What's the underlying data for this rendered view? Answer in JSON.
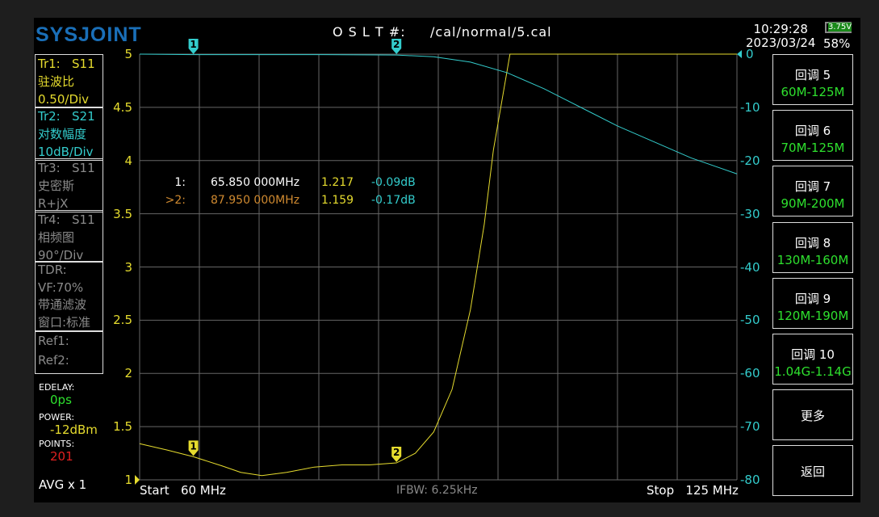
{
  "header": {
    "logo": "SYSJOINT",
    "cal_label": "O S L T #:",
    "cal_file": "/cal/normal/5.cal",
    "time": "10:29:28",
    "date": "2023/03/24",
    "battery_voltage": "3.75V",
    "battery_percent": "58%"
  },
  "traces": [
    {
      "l1": "Tr1:   S11",
      "l2": "驻波比",
      "l3": "0.50/Div"
    },
    {
      "l1": "Tr2:   S21",
      "l2": "对数幅度",
      "l3": "10dB/Div"
    },
    {
      "l1": "Tr3:   S11",
      "l2": "史密斯",
      "l3": "R+jX"
    },
    {
      "l1": "Tr4:   S11",
      "l2": "相频图",
      "l3": "90°/Div"
    },
    {
      "l1": "TDR:",
      "l2": "VF:70%",
      "l3": "带通滤波",
      "l4": "窗口:标准"
    },
    {
      "l1": "Ref1:",
      "l2": "Ref2:"
    }
  ],
  "status": {
    "edelay_label": "EDELAY:",
    "edelay": "0ps",
    "power_label": "POWER:",
    "power": "-12dBm",
    "points_label": "POINTS:",
    "points": "201",
    "avg": "AVG x 1"
  },
  "side_buttons": [
    {
      "l1": "回调 5",
      "l2": "60M-125M"
    },
    {
      "l1": "回调 6",
      "l2": "70M-125M"
    },
    {
      "l1": "回调 7",
      "l2": "90M-200M"
    },
    {
      "l1": "回调 8",
      "l2": "130M-160M"
    },
    {
      "l1": "回调 9",
      "l2": "120M-190M"
    },
    {
      "l1": "回调 10",
      "l2": "1.04G-1.14G"
    },
    {
      "l1": "更多"
    },
    {
      "l1": "返回"
    }
  ],
  "footer": {
    "start": "Start   60 MHz",
    "ifbw": "IFBW: 6.25kHz",
    "stop": "Stop   125 MHz"
  },
  "markers": [
    {
      "id": "1",
      "label": "1:",
      "freq": "65.850 000MHz",
      "swr": "1.217",
      "s21": "-0.09dB"
    },
    {
      "id": "2",
      "label": ">2:",
      "freq": "87.950 000MHz",
      "swr": "1.159",
      "s21": "-0.17dB"
    }
  ],
  "chart_data": {
    "type": "line",
    "x_range_mhz": [
      60,
      125
    ],
    "left_axis": {
      "ticks": [
        "5",
        "4.5",
        "4",
        "3.5",
        "3",
        "2.5",
        "2",
        "1.5",
        "1"
      ],
      "range": [
        1,
        5
      ]
    },
    "right_axis": {
      "ticks": [
        "0",
        "-10",
        "-20",
        "-30",
        "-40",
        "-50",
        "-60",
        "-70",
        "-80"
      ],
      "range": [
        -80,
        0
      ]
    },
    "series": [
      {
        "name": "Tr1 S11 SWR",
        "color": "#e6dc2e",
        "points": [
          [
            60,
            1.34
          ],
          [
            63,
            1.28
          ],
          [
            65.85,
            1.217
          ],
          [
            69,
            1.13
          ],
          [
            71,
            1.07
          ],
          [
            73.3,
            1.04
          ],
          [
            76,
            1.07
          ],
          [
            79,
            1.12
          ],
          [
            82,
            1.14
          ],
          [
            85,
            1.14
          ],
          [
            87.95,
            1.159
          ],
          [
            90,
            1.25
          ],
          [
            92,
            1.45
          ],
          [
            94,
            1.85
          ],
          [
            96,
            2.6
          ],
          [
            97.5,
            3.4
          ],
          [
            98.5,
            4.1
          ],
          [
            99.5,
            4.6
          ],
          [
            100.3,
            5
          ],
          [
            125,
            5
          ]
        ]
      },
      {
        "name": "Tr2 S21 LogMag",
        "color": "#33cccc",
        "points": [
          [
            60,
            0
          ],
          [
            65.85,
            -0.09
          ],
          [
            80,
            -0.1
          ],
          [
            87.95,
            -0.17
          ],
          [
            92,
            -0.5
          ],
          [
            96,
            -1.5
          ],
          [
            100,
            -3.5
          ],
          [
            104,
            -6.5
          ],
          [
            108,
            -10
          ],
          [
            112,
            -13.5
          ],
          [
            116,
            -16.5
          ],
          [
            120,
            -19.5
          ],
          [
            125,
            -22.5
          ]
        ]
      }
    ]
  }
}
